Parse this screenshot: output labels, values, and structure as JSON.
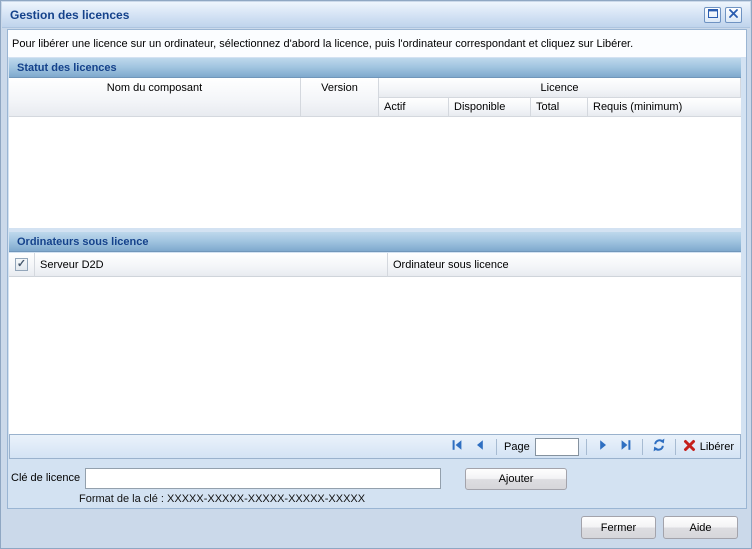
{
  "window": {
    "title": "Gestion des licences"
  },
  "instruction": "Pour libérer une licence sur un ordinateur, sélectionnez d'abord la licence, puis l'ordinateur correspondant et cliquez sur Libérer.",
  "license_status": {
    "header": "Statut des licences",
    "columns": {
      "component": "Nom du composant",
      "version": "Version",
      "license_group": "Licence",
      "active": "Actif",
      "available": "Disponible",
      "total": "Total",
      "required": "Requis (minimum)"
    },
    "rows": []
  },
  "licensed_machines": {
    "header": "Ordinateurs sous licence",
    "select_all_checked": true,
    "check_glyph": "✓",
    "columns": {
      "server": "Serveur D2D",
      "machine": "Ordinateur sous licence"
    },
    "rows": []
  },
  "pagination": {
    "page_label": "Page",
    "page_value": "",
    "release_label": "Libérer"
  },
  "license_key": {
    "label": "Clé de licence",
    "value": "",
    "add_label": "Ajouter",
    "format_hint": "Format de la clé : XXXXX-XXXXX-XXXXX-XXXXX-XXXXX"
  },
  "footer": {
    "close_label": "Fermer",
    "help_label": "Aide"
  },
  "colors": {
    "title_text": "#15428b",
    "section_gradient_top": "#bed8ec",
    "section_gradient_bottom": "#7fa9cd",
    "accent_blue": "#2f6fc1",
    "release_red": "#c5201c"
  }
}
